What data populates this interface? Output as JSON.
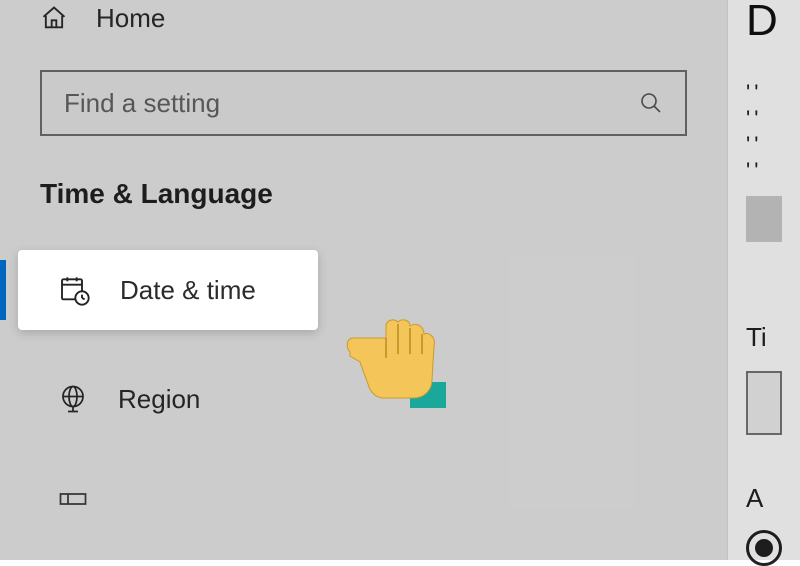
{
  "sidebar": {
    "home_label": "Home",
    "search_placeholder": "Find a setting",
    "section_title": "Time & Language",
    "items": [
      {
        "label": "Date & time"
      },
      {
        "label": "Region"
      }
    ]
  },
  "content": {
    "title_fragment": "D",
    "quotes": "'' '' '' ''",
    "label1_fragment": "Ti",
    "label2_fragment": "A"
  }
}
